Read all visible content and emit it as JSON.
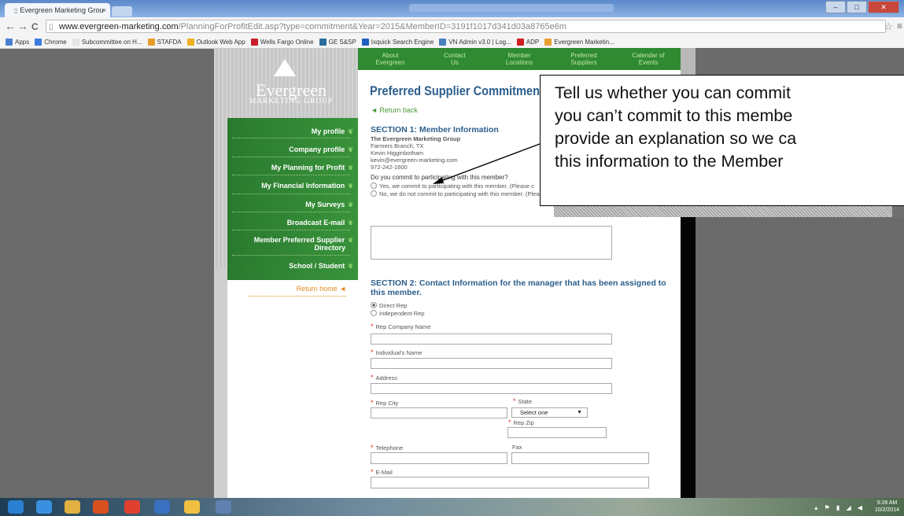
{
  "browser": {
    "tab_title": "Evergreen Marketing Grou",
    "tab_close": "×",
    "url_host": "www.evergreen-marketing.com",
    "url_path": "/PlanningForProfitEdit.asp?type=commitment&Year=2015&MemberID=3191f1017d341d03a8765e6m",
    "back": "←",
    "forward": "→",
    "reload": "C",
    "star": "☆",
    "menu": "≡",
    "win_min": "–",
    "win_max": "□",
    "win_close": "✕",
    "bookmarks": [
      {
        "label": "Apps",
        "color": "#4a7fd0"
      },
      {
        "label": "Chrome",
        "color": "#3c7be0"
      },
      {
        "label": "Subcommittee on H...",
        "color": "#e5e5e5"
      },
      {
        "label": "STAFDA",
        "color": "#e89c2a"
      },
      {
        "label": "Outlook Web App",
        "color": "#f0b020"
      },
      {
        "label": "Wells Fargo Online",
        "color": "#c8202a"
      },
      {
        "label": "GE S&SP",
        "color": "#2a6fa0"
      },
      {
        "label": "Ixquick Search Engine",
        "color": "#2060c0"
      },
      {
        "label": "VN Admin v3.0 | Log...",
        "color": "#4a80c0"
      },
      {
        "label": "ADP",
        "color": "#d02020"
      },
      {
        "label": "Evergreen Marketin...",
        "color": "#e8a030"
      }
    ]
  },
  "site": {
    "logo_name": "Evergreen",
    "logo_sub": "MARKETING GROUP",
    "topnav": [
      {
        "l1": "About",
        "l2": "Evergreen"
      },
      {
        "l1": "Contact",
        "l2": "Us"
      },
      {
        "l1": "Member",
        "l2": "Locations"
      },
      {
        "l1": "Preferred",
        "l2": "Suppliers"
      },
      {
        "l1": "Calendar of",
        "l2": "Events"
      }
    ],
    "sidenav": [
      "My profile",
      "Company profile",
      "My Planning for Profit",
      "My Financial Information",
      "My Surveys",
      "Broadcast E-mail",
      "Member Preferred Supplier",
      "Directory",
      "School / Student"
    ],
    "sidenav_leaf": "❦",
    "return_home": "Return home ◄"
  },
  "form": {
    "title": "Preferred Supplier Commitment Form",
    "return_back": "◄ Return back",
    "section1_title": "SECTION 1: Member Information",
    "member_name": "The Evergreen Marketing Group",
    "member_city": "Farmers Branch, TX",
    "member_contact": "Kevin Higginbotham",
    "member_email": "kevin@evergreen-marketing.com",
    "member_phone": "972-242-1600",
    "commit_question": "Do you commit to participating with this member?",
    "commit_yes": "Yes, we commit to participating with this member. (Please c",
    "commit_no": "No, we do not commit to participating with this member. (Please explain)",
    "section2_line1": "SECTION 2: Contact Information for the manager that has been assigned to",
    "section2_line2": "this member.",
    "rep_direct": "Direct Rep",
    "rep_independent": "Independent Rep",
    "req_mark": "*",
    "label_company": "Rep Company Name",
    "label_individual": "Individual's Name",
    "label_address": "Address",
    "label_city": "Rep City",
    "label_state": "State",
    "state_value": "Select one",
    "label_zip": "Rep Zip",
    "label_phone": "Telephone",
    "label_fax": "Fax",
    "label_email": "E-Mail"
  },
  "callout": {
    "line1": "Tell us whether you can commit",
    "line2": "you can’t commit to this membe",
    "line3": "provide an explanation so we ca",
    "line4": "this information to the Member"
  },
  "taskbar": {
    "clock_time": "9:28 AM",
    "clock_date": "10/2/2014",
    "icons": [
      "#2a7fd0",
      "#3a90e0",
      "#e0b040",
      "#d85020",
      "#e04030",
      "#3a70c0",
      "#f0c040",
      "#6080b0"
    ]
  }
}
